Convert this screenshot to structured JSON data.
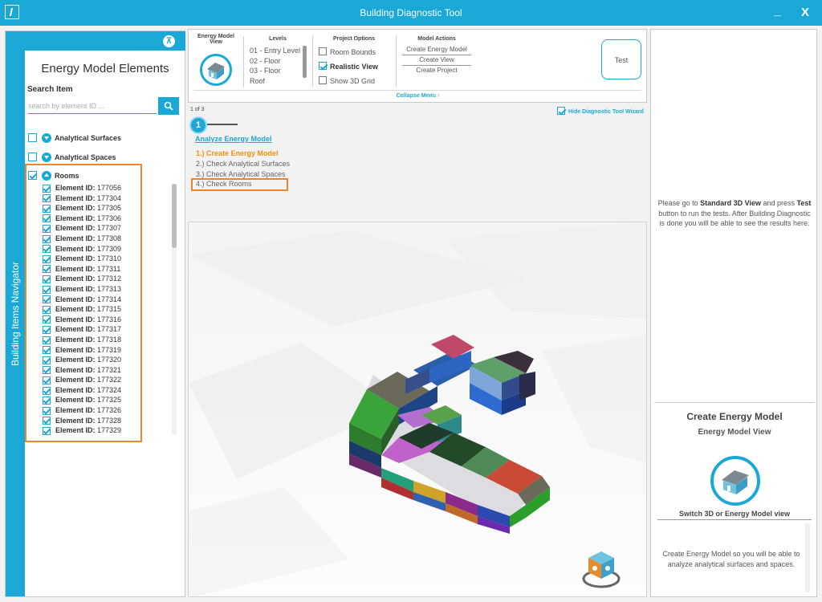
{
  "window": {
    "title": "Building Diagnostic Tool",
    "minimize": "_",
    "close": "X"
  },
  "navigator": {
    "tab_label": "Building Items Navigator",
    "heading": "Energy Model Elements",
    "search_label": "Search Item",
    "search_placeholder": "search by element ID ...",
    "categories": [
      {
        "label": "Analytical Surfaces",
        "checked": false,
        "expanded": false
      },
      {
        "label": "Analytical Spaces",
        "checked": false,
        "expanded": false
      },
      {
        "label": "Rooms",
        "checked": true,
        "expanded": true
      }
    ],
    "rooms": [
      {
        "prefix": "Element ID:",
        "id": "177056"
      },
      {
        "prefix": "Element ID:",
        "id": "177304"
      },
      {
        "prefix": "Element ID:",
        "id": "177305"
      },
      {
        "prefix": "Element ID:",
        "id": "177306"
      },
      {
        "prefix": "Element ID:",
        "id": "177307"
      },
      {
        "prefix": "Element ID:",
        "id": "177308"
      },
      {
        "prefix": "Element ID:",
        "id": "177309"
      },
      {
        "prefix": "Element ID:",
        "id": "177310"
      },
      {
        "prefix": "Element ID:",
        "id": "177311"
      },
      {
        "prefix": "Element ID:",
        "id": "177312"
      },
      {
        "prefix": "Element ID:",
        "id": "177313"
      },
      {
        "prefix": "Element ID:",
        "id": "177314"
      },
      {
        "prefix": "Element ID:",
        "id": "177315"
      },
      {
        "prefix": "Element ID:",
        "id": "177316"
      },
      {
        "prefix": "Element ID:",
        "id": "177317"
      },
      {
        "prefix": "Element ID:",
        "id": "177318"
      },
      {
        "prefix": "Element ID:",
        "id": "177319"
      },
      {
        "prefix": "Element ID:",
        "id": "177320"
      },
      {
        "prefix": "Element ID:",
        "id": "177321"
      },
      {
        "prefix": "Element ID:",
        "id": "177322"
      },
      {
        "prefix": "Element ID:",
        "id": "177324"
      },
      {
        "prefix": "Element ID:",
        "id": "177325"
      },
      {
        "prefix": "Element ID:",
        "id": "177326"
      },
      {
        "prefix": "Element ID:",
        "id": "177328"
      },
      {
        "prefix": "Element ID:",
        "id": "177329"
      }
    ]
  },
  "ribbon": {
    "view_heading": "Energy Model View",
    "levels_heading": "Levels",
    "levels": [
      "01 - Entry Level",
      "02 - Floor",
      "03 - Floor",
      "Roof"
    ],
    "options_heading": "Project Options",
    "options": [
      {
        "label": "Room Bounds",
        "checked": false
      },
      {
        "label": "Realistic View",
        "checked": true
      },
      {
        "label": "Show 3D Grid",
        "checked": false
      }
    ],
    "actions_heading": "Model Actions",
    "actions": [
      "Create Energy Model",
      "Create View",
      "Create Project"
    ],
    "test_label": "Test",
    "collapse_label": "Collapse Menu ↑"
  },
  "wizard": {
    "pager": "1 of 3",
    "hide_label": "Hide Diagnostic Tool Wizard",
    "step_number": "1",
    "title": "Analyze Energy Model",
    "steps": [
      "1.) Create Energy Model",
      "2.) Check Analytical Surfaces",
      "3.) Check Analytical Spaces",
      "4.) Check Rooms"
    ]
  },
  "results": {
    "info_pre": "Please go to ",
    "info_bold1": "Standard 3D View",
    "info_mid": " and press ",
    "info_bold2": "Test",
    "info_post": " button to run the tests. After Building Diagnostic is done you will be able to see the results here.",
    "card_title": "Create Energy Model",
    "card_subtitle": "Energy Model View",
    "card_caption": "Switch 3D or Energy Model view",
    "card_desc": "Create Energy Model so you will be able to analyze analytical surfaces and spaces."
  },
  "colors": {
    "accent": "#1aa9d6",
    "highlight": "#e8882c",
    "active_step": "#f29010"
  }
}
